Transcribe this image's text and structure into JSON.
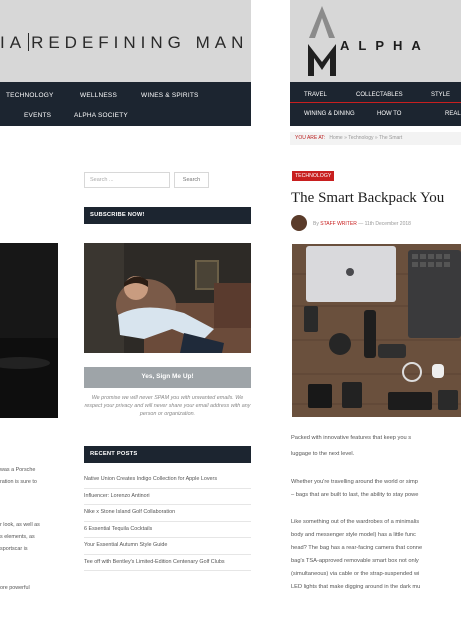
{
  "left": {
    "brand_left": "IA",
    "brand_right": "REDEFINING MAN",
    "nav": [
      "TECHNOLOGY",
      "WELLNESS",
      "WINES & SPIRITS",
      "EVENTS",
      "ALPHA SOCIETY"
    ],
    "search_placeholder": "Search ...",
    "search_button": "Search",
    "subscribe_heading": "SUBSCRIBE NOW!",
    "cta_label": "Yes, Sign Me Up!",
    "promise": "We promise we will never SPAM you with unwanted emails. We respect your privacy and will never share your email address with any person or organization.",
    "recent_heading": "RECENT POSTS",
    "recent_posts": [
      "Native Union Creates Indigo Collection for Apple Lovers",
      "Influencer: Lorenzo Antinori",
      "Nike x Stone Island Golf Collaboration",
      "6 Essential Tequila Cocktails",
      "Your Essential Autumn Style Guide",
      "Tee off with Bentley's Limited-Edition Centenary Golf Clubs"
    ],
    "fragments": [
      "was a Porsche",
      "ration is sure to",
      "r look, as well as",
      "s elements, as",
      "sportscar is",
      "ore powerful"
    ]
  },
  "right": {
    "logo_letters": [
      "A",
      "M"
    ],
    "brand": "ALPHA",
    "nav_row1": [
      "TRAVEL",
      "COLLECTABLES",
      "STYLE"
    ],
    "nav_row2": [
      "WINING & DINING",
      "HOW TO",
      "REAL"
    ],
    "crumbs_label": "YOU ARE AT:",
    "crumbs": [
      "Home",
      "»",
      "Technology",
      "»",
      "The Smart"
    ],
    "tag": "TECHNOLOGY",
    "title": "The Smart Backpack You",
    "byline_by": "By",
    "byline_author": "STAFF WRITER",
    "byline_date": "— 11th December 2018",
    "body": [
      "Packed with innovative features that keep you s",
      "luggage to the next level.",
      "Whether you're travelling around the world or simp",
      "– bags that are built to last, the ability to stay powe",
      "Like something out of the wardrobes of a minimalis",
      "body and messenger style model) has a little func",
      "head? The bag has a rear-facing camera that conne",
      "bag's TSA-approved removable smart box not only",
      "(simultaneous) via cable or the strap-suspended wi",
      "LED lights that make digging around in the dark mu"
    ]
  },
  "colors": {
    "nav": "#1c2530",
    "header": "#d7d7d7",
    "accent_red": "#c81f1f",
    "cta": "#9ea4a8"
  },
  "icons": [
    "search-icon",
    "avatar-icon"
  ]
}
